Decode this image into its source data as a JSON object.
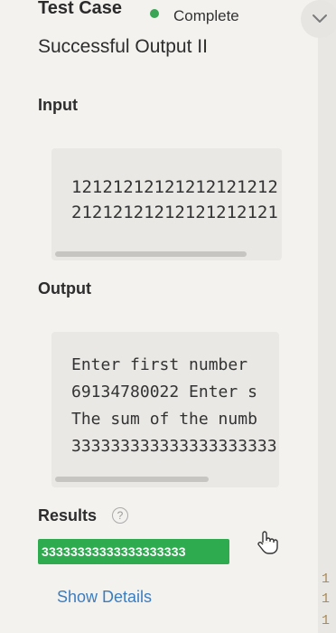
{
  "header": {
    "title": "Test Case",
    "status": "Complete",
    "colors": {
      "status_dot": "#3aa655",
      "accent_link": "#3b7dbf",
      "result_badge": "#2eab4f"
    }
  },
  "subtitle": "Successful Output II",
  "input": {
    "label": "Input",
    "lines": [
      "12121212121212121212",
      "21212121212121212121"
    ]
  },
  "output": {
    "label": "Output",
    "lines": [
      "Enter first number",
      "69134780022 Enter s",
      "The sum of the numb",
      "333333333333333333333"
    ]
  },
  "results": {
    "label": "Results",
    "help_icon": "question-circle-icon",
    "value": "33333333333333333333"
  },
  "show_details": "Show Details",
  "icons": {
    "collapse": "chevron-down-icon",
    "cursor": "hand-pointer-icon"
  },
  "edge_glyphs": [
    "1",
    "1",
    "1"
  ]
}
